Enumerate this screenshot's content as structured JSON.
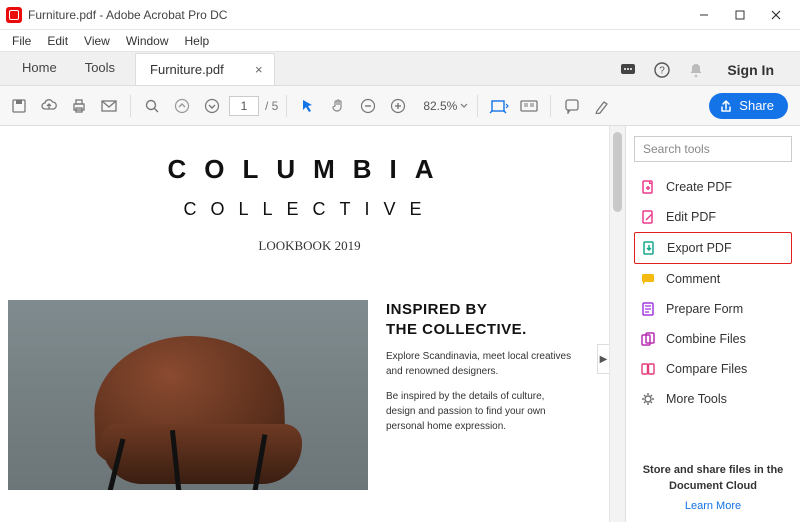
{
  "window": {
    "title": "Furniture.pdf - Adobe Acrobat Pro DC"
  },
  "menu": {
    "file": "File",
    "edit": "Edit",
    "view": "View",
    "window": "Window",
    "help": "Help"
  },
  "tabs": {
    "home": "Home",
    "tools": "Tools",
    "doc": "Furniture.pdf",
    "signin": "Sign In"
  },
  "toolbar": {
    "page_current": "1",
    "page_total": "/ 5",
    "zoom": "82.5%",
    "share": "Share"
  },
  "document": {
    "heading1": "COLUMBIA",
    "heading2": "COLLECTIVE",
    "lookbook": "LOOKBOOK 2019",
    "inspired_line1": "INSPIRED BY",
    "inspired_line2": "THE COLLECTIVE.",
    "para1": "Explore Scandinavia, meet local creatives and renowned designers.",
    "para2": "Be inspired by the details of culture, design and passion to find your own personal home expression."
  },
  "rightpane": {
    "search_placeholder": "Search tools",
    "tools": [
      {
        "label": "Create PDF",
        "icon": "create-pdf-icon",
        "color": "#ec3a8b"
      },
      {
        "label": "Edit PDF",
        "icon": "edit-pdf-icon",
        "color": "#ec3a8b"
      },
      {
        "label": "Export PDF",
        "icon": "export-pdf-icon",
        "color": "#17a88b",
        "highlight": true
      },
      {
        "label": "Comment",
        "icon": "comment-icon",
        "color": "#f5b90f"
      },
      {
        "label": "Prepare Form",
        "icon": "prepare-form-icon",
        "color": "#a13ae2"
      },
      {
        "label": "Combine Files",
        "icon": "combine-files-icon",
        "color": "#b82fb4"
      },
      {
        "label": "Compare Files",
        "icon": "compare-files-icon",
        "color": "#e23a7a"
      },
      {
        "label": "More Tools",
        "icon": "more-tools-icon",
        "color": "#6d6d6d"
      }
    ],
    "cloud_note": "Store and share files in the Document Cloud",
    "learn_more": "Learn More"
  }
}
